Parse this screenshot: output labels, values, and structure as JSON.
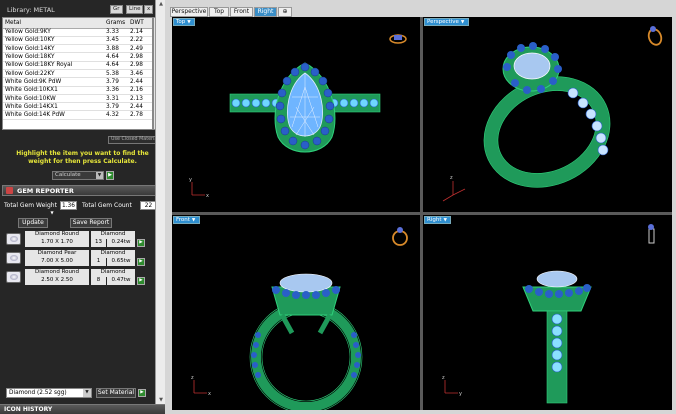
{
  "library": {
    "title": "Library: METAL",
    "btn_gr": "Gr",
    "btn_line": "Line"
  },
  "metal_table": {
    "headers": [
      "Metal",
      "Grams",
      "DWT"
    ],
    "rows": [
      [
        "Yellow Gold:9KY",
        "3.33",
        "2.14"
      ],
      [
        "Yellow Gold:10KY",
        "3.45",
        "2.22"
      ],
      [
        "Yellow Gold:14KY",
        "3.88",
        "2.49"
      ],
      [
        "Yellow Gold:18KY",
        "4.64",
        "2.98"
      ],
      [
        "Yellow Gold:18KY Royal",
        "4.64",
        "2.98"
      ],
      [
        "Yellow Gold:22KY",
        "5.38",
        "3.46"
      ],
      [
        "White Gold:9K PdW",
        "3.79",
        "2.44"
      ],
      [
        "White Gold:10KX1",
        "3.36",
        "2.16"
      ],
      [
        "White Gold:10KW",
        "3.31",
        "2.13"
      ],
      [
        "White Gold:14KX1",
        "3.79",
        "2.44"
      ],
      [
        "White Gold:14K PdW",
        "4.32",
        "2.78"
      ]
    ]
  },
  "closed_materials": "Use Closed Materials",
  "hint": "Highlight the item you want to find the weight for then press Calculate.",
  "calculate_select": "Calculate",
  "gem_reporter": {
    "title": "GEM REPORTER",
    "total_weight_label": "Total Gem Weight",
    "total_weight_value": "1.36",
    "total_count_label": "Total Gem Count",
    "total_count_value": "22",
    "update_label": "Update",
    "save_label": "Save Report",
    "gems": [
      {
        "name": "Diamond Round",
        "size": "1.70 X 1.70",
        "type": "Diamond",
        "count": "13",
        "weight": "0.24tw"
      },
      {
        "name": "Diamond Pear",
        "size": "7.00 X 5.00",
        "type": "Diamond",
        "count": "1",
        "weight": "0.65tw"
      },
      {
        "name": "Diamond Round",
        "size": "2.50 X 2.50",
        "type": "Diamond",
        "count": "8",
        "weight": "0.47tw"
      }
    ],
    "material_select": "Diamond  (2.52 sgg)",
    "set_material_label": "Set Material"
  },
  "icon_history": "ICON HISTORY",
  "view_tabs": [
    "Perspective",
    "Top",
    "Front",
    "Right"
  ],
  "active_tab": "Right",
  "viewports": {
    "top": "Top",
    "perspective": "Perspective",
    "front": "Front",
    "right": "Right"
  },
  "axes": {
    "x": "x",
    "y": "y",
    "z": "z"
  },
  "colors": {
    "metal": "#1f9a5a",
    "gem_pave": "#2a5fc8",
    "center_stone": "#a8c8f0",
    "viewport_label": "#2f8fd0",
    "hint": "#e6e63a",
    "active_tab": "#3a8ec7"
  }
}
